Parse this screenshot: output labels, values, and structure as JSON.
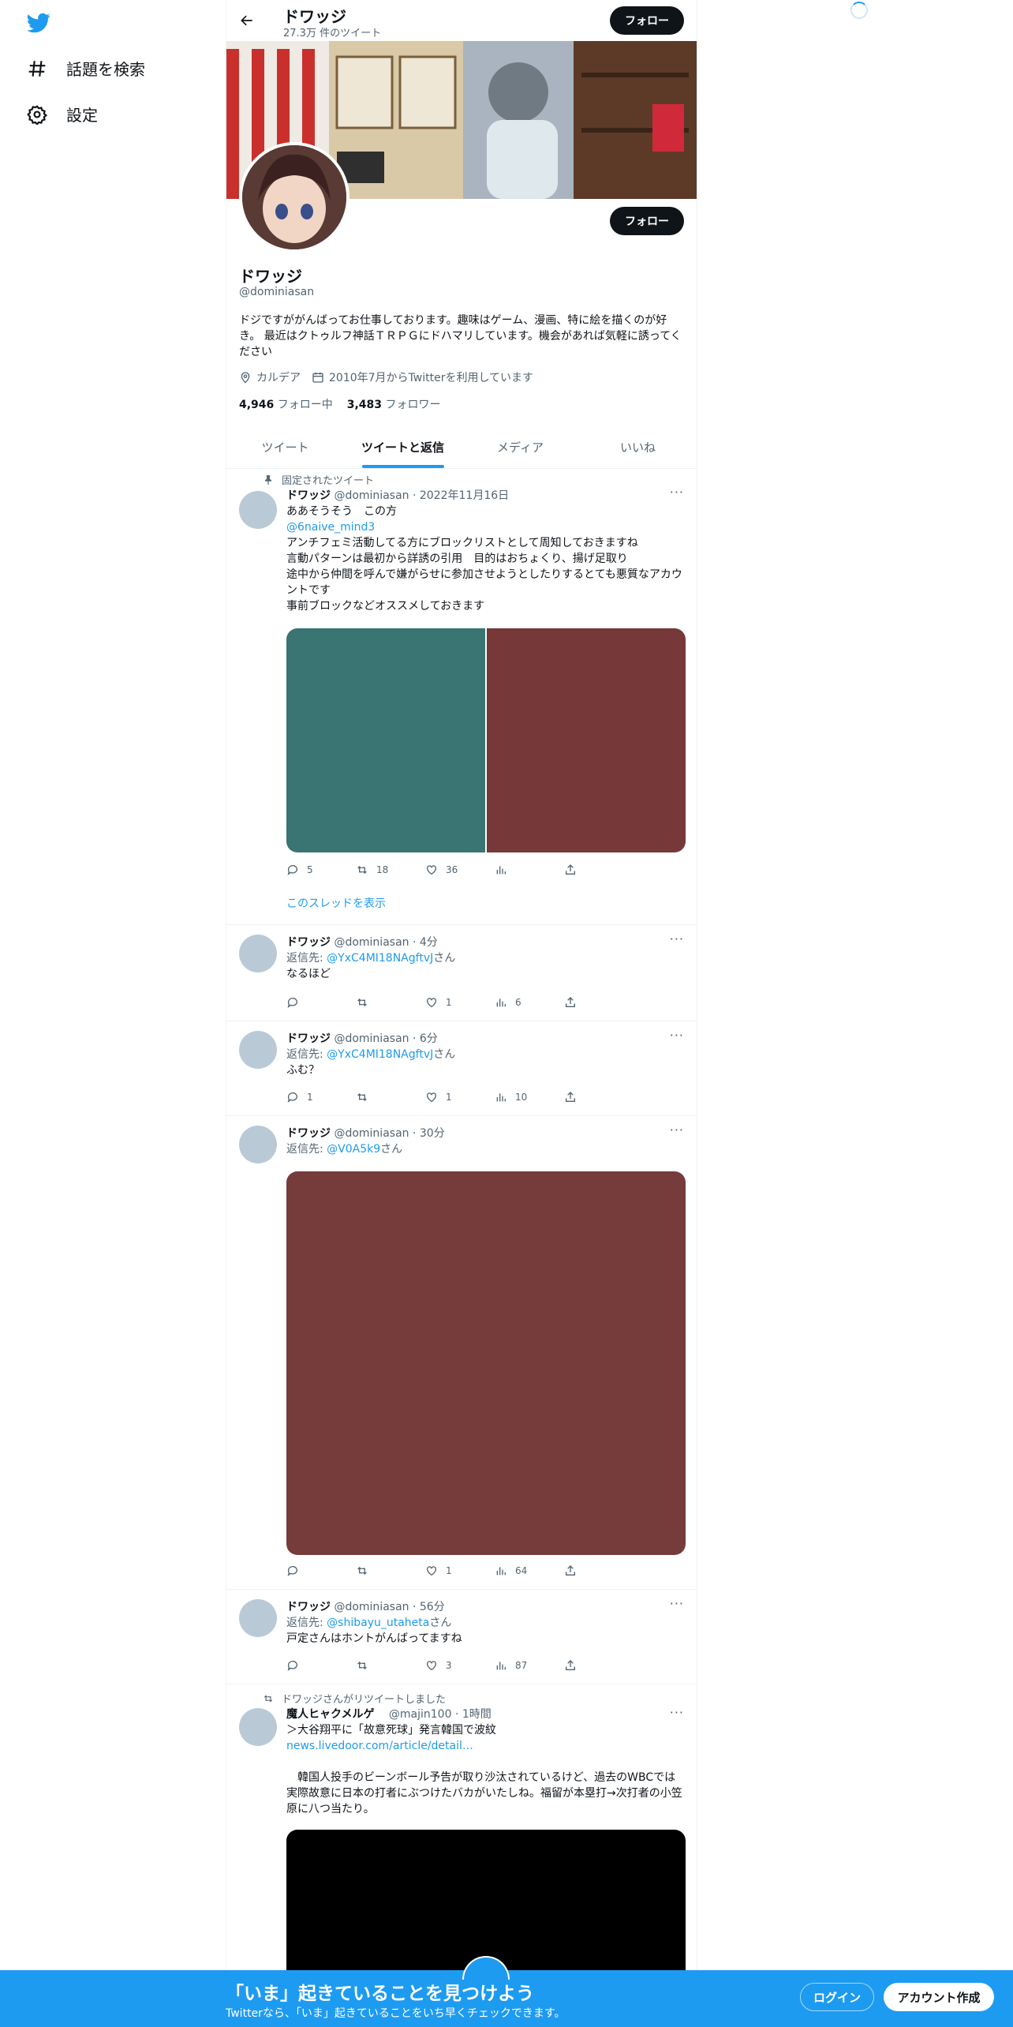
{
  "nav": {
    "items": [
      {
        "label": "話題を検索",
        "icon": "hashtag-icon"
      },
      {
        "label": "設定",
        "icon": "gear-icon"
      }
    ]
  },
  "header": {
    "name": "ドワッジ",
    "tweet_count": "27.3万 件のツイート",
    "follow_label": "フォロー"
  },
  "profile": {
    "name": "ドワッジ",
    "handle": "@dominiasan",
    "bio": "ドジですががんばってお仕事しております。趣味はゲーム、漫画、特に絵を描くのが好き。 最近はクトゥルフ神話ＴＲＰＧにドハマリしています。機会があれば気軽に誘ってください",
    "location": "カルデア",
    "joined": "2010年7月からTwitterを利用しています",
    "following_count": "4,946",
    "following_label": "フォロー中",
    "followers_count": "3,483",
    "followers_label": "フォロワー",
    "follow_label": "フォロー"
  },
  "tabs": [
    {
      "label": "ツイート",
      "active": false
    },
    {
      "label": "ツイートと返信",
      "active": true
    },
    {
      "label": "メディア",
      "active": false
    },
    {
      "label": "いいね",
      "active": false
    }
  ],
  "tweets": [
    {
      "context": "固定されたツイート",
      "name": "ドワッジ",
      "handle": "@dominiasan",
      "time": "2022年11月16日",
      "line1": "ああそうそう　この方",
      "mention": "@6naive_mind3",
      "line2": "アンチフェミ活動してる方にブロックリストとして周知しておきますね",
      "line3": "言動パターンは最初から詳誘の引用　目的はおちょくり、揚げ足取り",
      "line4": "途中から仲間を呼んで嫌がらせに参加させようとしたりするとても悪質なアカウントです",
      "line5": "事前ブロックなどオススメしておきます",
      "media_colors": [
        "#3a7473",
        "#763838"
      ],
      "replies": "5",
      "retweets": "18",
      "likes": "36",
      "thread_link": "このスレッドを表示"
    },
    {
      "name": "ドワッジ",
      "handle": "@dominiasan",
      "time": "4分",
      "reply_prefix": "返信先: ",
      "reply_to": "@YxC4MI18NAgftvJ",
      "reply_suffix": "さん",
      "text": "なるほど",
      "likes": "1",
      "views": "6"
    },
    {
      "name": "ドワッジ",
      "handle": "@dominiasan",
      "time": "6分",
      "reply_prefix": "返信先: ",
      "reply_to": "@YxC4MI18NAgftvJ",
      "reply_suffix": "さん",
      "text": "ふむ？",
      "replies": "1",
      "likes": "1",
      "views": "10"
    },
    {
      "name": "ドワッジ",
      "handle": "@dominiasan",
      "time": "30分",
      "reply_prefix": "返信先: ",
      "reply_to": "@V0A5k9",
      "reply_suffix": "さん",
      "media_color": "#763c3c",
      "likes": "1",
      "views": "64"
    },
    {
      "name": "ドワッジ",
      "handle": "@dominiasan",
      "time": "56分",
      "reply_prefix": "返信先: ",
      "reply_to": "@shibayu_utaheta",
      "reply_suffix": "さん",
      "text": "戸定さんはホントがんばってますね",
      "likes": "3",
      "views": "87"
    },
    {
      "context": "ドワッジさんがリツイートしました",
      "name": "魔人ヒャクメルゲ",
      "handle": "@majin100",
      "time": "1時間",
      "line1": "＞大谷翔平に「故意死球」発言韓国で波紋",
      "link": "news.livedoor.com/article/detail…",
      "line2": "　韓国人投手のビーンボール予告が取り沙汰されているけど、過去のWBCでは実際故意に日本の打者にぶつけたバカがいたしね。福留が本塁打→次打者の小笠原に八つ当たり。",
      "media_color": "#000000"
    }
  ],
  "bottom_bar": {
    "title": "「いま」起きていることを見つけよう",
    "subtitle": "Twitterなら、「いま」起きていることをいち早くチェックできます。",
    "login": "ログイン",
    "signup": "アカウント作成"
  },
  "colors": {
    "accent": "#1d9bf0",
    "text": "#0f1419",
    "muted": "#536471",
    "bottom_bar": "#1d9bf0"
  }
}
